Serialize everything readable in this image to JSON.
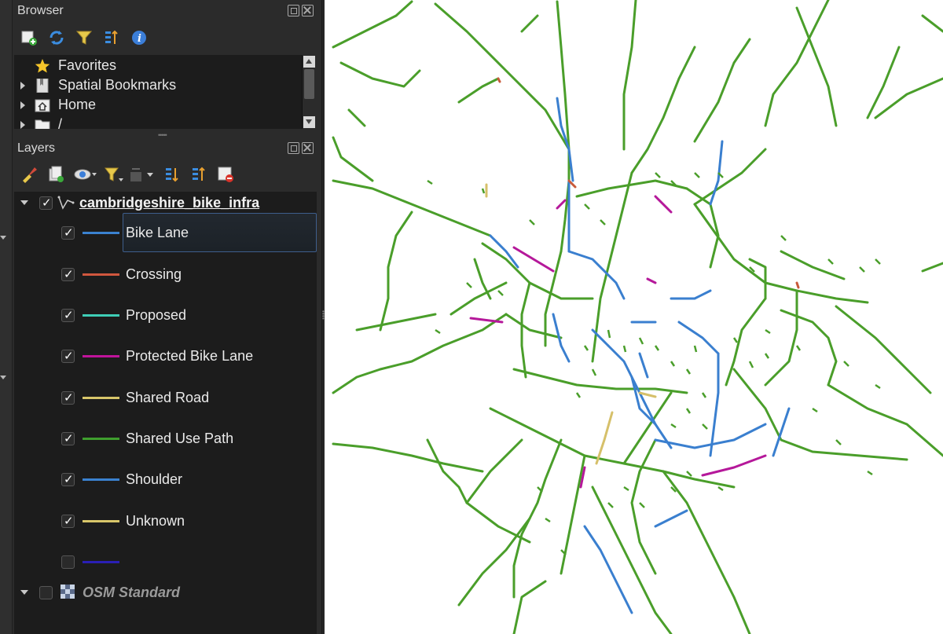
{
  "browser_panel": {
    "title": "Browser",
    "toolbar_icons": [
      "add-layer-icon",
      "refresh-icon",
      "filter-icon",
      "collapse-all-icon",
      "info-icon"
    ],
    "items": [
      {
        "label": "Favorites",
        "icon": "star-icon",
        "expandable": false
      },
      {
        "label": "Spatial Bookmarks",
        "icon": "bookmark-icon",
        "expandable": true
      },
      {
        "label": "Home",
        "icon": "home-folder-icon",
        "expandable": true
      },
      {
        "label": "/",
        "icon": "folder-icon",
        "expandable": true
      }
    ]
  },
  "layers_panel": {
    "title": "Layers",
    "toolbar_icons": [
      "style-brush-icon",
      "add-group-icon",
      "visibility-eye-icon",
      "filter-legend-icon",
      "expression-filter-icon",
      "expand-all-icon",
      "collapse-all-icon",
      "remove-layer-icon"
    ],
    "layer_group": {
      "name": "cambridgeshire_bike_infra",
      "checked": true,
      "classes": [
        {
          "label": "Bike Lane",
          "color": "#3b82d0",
          "checked": true,
          "selected": true
        },
        {
          "label": "Crossing",
          "color": "#d0573e",
          "checked": true
        },
        {
          "label": "Proposed",
          "color": "#3ecdb6",
          "checked": true
        },
        {
          "label": "Protected Bike Lane",
          "color": "#c0149b",
          "checked": true
        },
        {
          "label": "Shared Road",
          "color": "#d8c66a",
          "checked": true
        },
        {
          "label": "Shared Use Path",
          "color": "#3f9e2e",
          "checked": true
        },
        {
          "label": "Shoulder",
          "color": "#3b82d0",
          "checked": true
        },
        {
          "label": "Unknown",
          "color": "#d8c66a",
          "checked": true
        },
        {
          "label": "",
          "color": "#2a1fb5",
          "checked": false
        }
      ]
    },
    "basemap": {
      "name": "OSM Standard",
      "checked": false,
      "icon": "xyz-tile-icon"
    }
  },
  "map": {
    "colors": {
      "path": "#4a9e2a",
      "lane": "#3a7fcf",
      "protected": "#b5189a",
      "shared": "#d6c06a",
      "crossing": "#c85a3a"
    }
  }
}
